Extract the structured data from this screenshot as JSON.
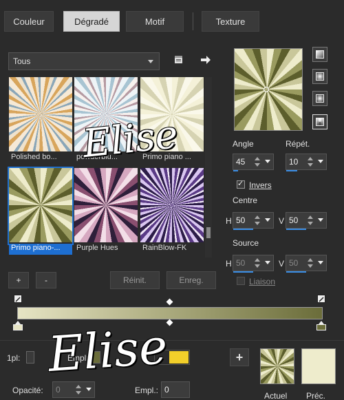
{
  "tabs": [
    {
      "label": "Couleur",
      "active": false
    },
    {
      "label": "Dégradé",
      "active": true
    },
    {
      "label": "Motif",
      "active": false
    },
    {
      "label": "Texture",
      "active": false
    }
  ],
  "filter": {
    "selected": "Tous"
  },
  "gallery": {
    "items": [
      {
        "label": "Polished bo..."
      },
      {
        "label": "powderblu..."
      },
      {
        "label": "Primo piano ..."
      },
      {
        "label": "Primo piano-...",
        "selected": true
      },
      {
        "label": "Purple Hues"
      },
      {
        "label": "RainBlow-FK"
      }
    ]
  },
  "list_buttons": {
    "add": "+",
    "remove": "-",
    "reset": "Réinit.",
    "save": "Enreg."
  },
  "angle": {
    "label": "Angle",
    "value": "45"
  },
  "repeat": {
    "label": "Répét.",
    "value": "10"
  },
  "invert": {
    "label": "Invers",
    "checked": true
  },
  "center": {
    "label": "Centre",
    "h_label": "H",
    "h_value": "50",
    "v_label": "V",
    "v_value": "50"
  },
  "source": {
    "label": "Source",
    "h_label": "H",
    "h_value": "50",
    "v_label": "V",
    "v_value": "50"
  },
  "link": {
    "label": "Liaison",
    "checked": false
  },
  "stops": {
    "colors": [
      "#e6e4c4",
      "#6b6d3a"
    ]
  },
  "bottom": {
    "pl_label": "1pl:",
    "empl_short": "Empl:",
    "opacity_label": "Opacité:",
    "opacity_value": "0",
    "empl_label": "Empl.:",
    "empl_value": "0",
    "swatch_color": "#f2cf2a",
    "add_button": "+",
    "current_label": "Actuel",
    "previous_label": "Préc."
  },
  "watermark": {
    "text": "Elise"
  }
}
